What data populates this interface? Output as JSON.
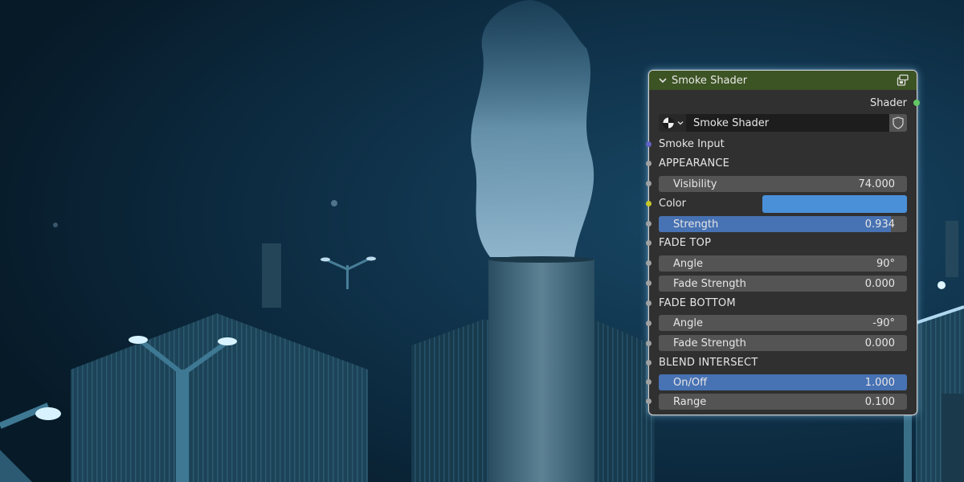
{
  "node": {
    "title": "Smoke Shader",
    "output_label": "Shader",
    "selector_name": "Smoke Shader",
    "smoke_input_label": "Smoke Input",
    "appearance": {
      "section": "APPEARANCE",
      "visibility_label": "Visibility",
      "visibility_value": "74.000",
      "color_label": "Color",
      "color_value": "#4a90d9",
      "strength_label": "Strength",
      "strength_value": "0.934",
      "strength_fraction": 0.934
    },
    "fade_top": {
      "section": "FADE TOP",
      "angle_label": "Angle",
      "angle_value": "90°",
      "fade_strength_label": "Fade Strength",
      "fade_strength_value": "0.000"
    },
    "fade_bottom": {
      "section": "FADE BOTTOM",
      "angle_label": "Angle",
      "angle_value": "-90°",
      "fade_strength_label": "Fade Strength",
      "fade_strength_value": "0.000"
    },
    "blend_intersect": {
      "section": "BLEND INTERSECT",
      "onoff_label": "On/Off",
      "onoff_value": "1.000",
      "onoff_fraction": 1.0,
      "range_label": "Range",
      "range_value": "0.100"
    }
  },
  "colors": {
    "header": "#3c5323",
    "body": "#303030",
    "field": "#545454",
    "accent_blue": "#4772b3",
    "shader_socket": "#63c763",
    "vector_socket": "#6363c7",
    "color_socket": "#c7c729",
    "scene_bg": "#0a2233"
  }
}
